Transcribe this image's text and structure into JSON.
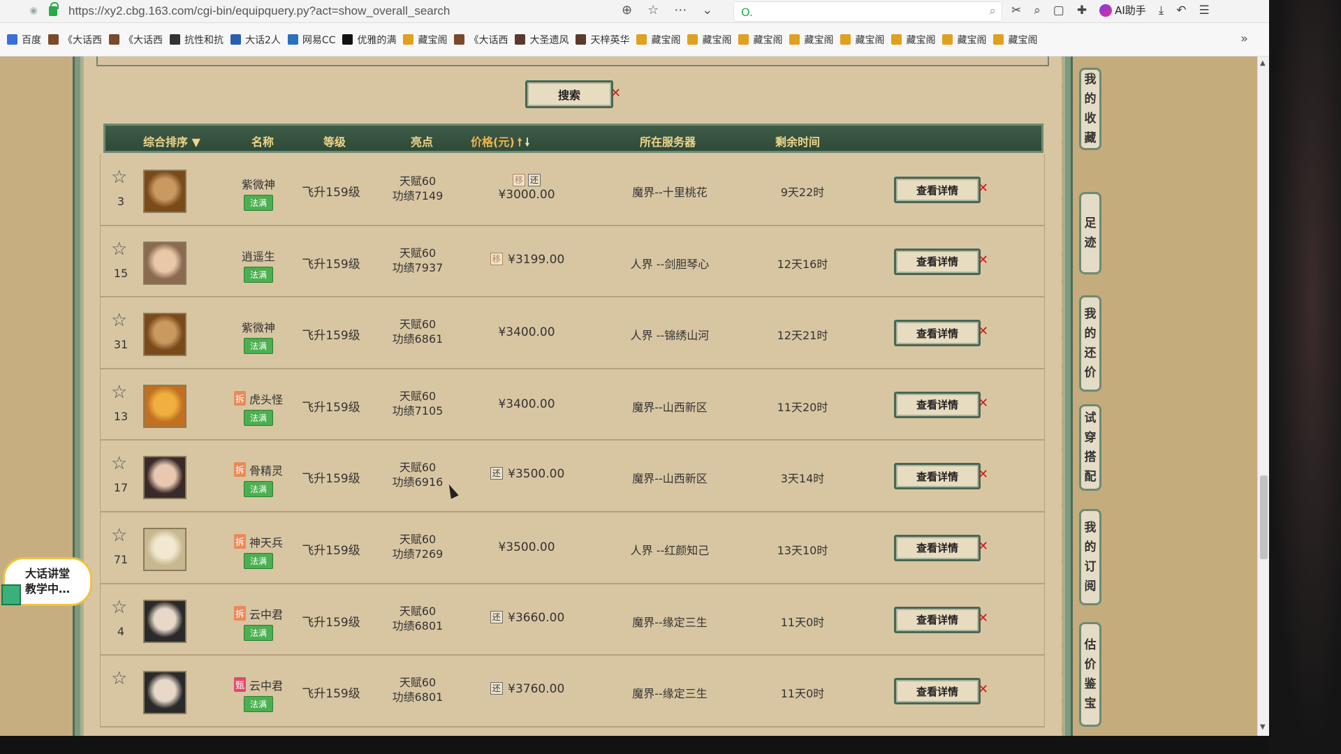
{
  "browser": {
    "url": "https://xy2.cbg.163.com/cgi-bin/equipquery.py?act=show_overall_search",
    "ai_label": "AI助手",
    "bookmarks": [
      "百度",
      "《大话西",
      "《大话西",
      "抗性和抗",
      "大话2人",
      "网易CC",
      "优雅的满",
      "藏宝阁",
      "《大话西",
      "大圣遗风",
      "天梓英华",
      "藏宝阁",
      "藏宝阁",
      "藏宝阁",
      "藏宝阁",
      "藏宝阁",
      "藏宝阁",
      "藏宝阁",
      "藏宝阁"
    ]
  },
  "search_button": "搜索",
  "table": {
    "headers": {
      "sort": "综合排序",
      "name": "名称",
      "level": "等级",
      "highlight": "亮点",
      "price": "价格(元)",
      "server": "所在服务器",
      "time": "剩余时间"
    },
    "detail_label": "查看详情",
    "rows": [
      {
        "rank": "3",
        "name": "紫微神",
        "tag": "",
        "badge": "法满",
        "level": "飞升159级",
        "hl1": "天赋60",
        "hl2": "功绩7149",
        "tags": [
          "移",
          "还"
        ],
        "price": "¥3000.00",
        "server": "魔界--十里桃花",
        "time": "9天22时"
      },
      {
        "rank": "15",
        "name": "逍遥生",
        "tag": "",
        "badge": "法满",
        "level": "飞升159级",
        "hl1": "天赋60",
        "hl2": "功绩7937",
        "tags": [
          "移"
        ],
        "price": "¥3199.00",
        "server": "人界 --剑胆琴心",
        "time": "12天16时"
      },
      {
        "rank": "31",
        "name": "紫微神",
        "tag": "",
        "badge": "法满",
        "level": "飞升159级",
        "hl1": "天赋60",
        "hl2": "功绩6861",
        "tags": [],
        "price": "¥3400.00",
        "server": "人界 --锦绣山河",
        "time": "12天21时"
      },
      {
        "rank": "13",
        "name": "虎头怪",
        "tag": "拆",
        "badge": "法满",
        "level": "飞升159级",
        "hl1": "天赋60",
        "hl2": "功绩7105",
        "tags": [],
        "price": "¥3400.00",
        "server": "魔界--山西新区",
        "time": "11天20时"
      },
      {
        "rank": "17",
        "name": "骨精灵",
        "tag": "拆",
        "badge": "法满",
        "level": "飞升159级",
        "hl1": "天赋60",
        "hl2": "功绩6916",
        "tags": [
          "还"
        ],
        "price": "¥3500.00",
        "server": "魔界--山西新区",
        "time": "3天14时"
      },
      {
        "rank": "71",
        "name": "神天兵",
        "tag": "拆",
        "badge": "法满",
        "level": "飞升159级",
        "hl1": "天赋60",
        "hl2": "功绩7269",
        "tags": [],
        "price": "¥3500.00",
        "server": "人界 --红颜知己",
        "time": "13天10时"
      },
      {
        "rank": "4",
        "name": "云中君",
        "tag": "拆",
        "badge": "法满",
        "level": "飞升159级",
        "hl1": "天赋60",
        "hl2": "功绩6801",
        "tags": [
          "还"
        ],
        "price": "¥3660.00",
        "server": "魔界--缘定三生",
        "time": "11天0时"
      },
      {
        "rank": "",
        "name": "云中君",
        "tag": "甄",
        "badge": "法满",
        "level": "飞升159级",
        "hl1": "天赋60",
        "hl2": "功绩6801",
        "tags": [
          "还"
        ],
        "price": "¥3760.00",
        "server": "魔界--缘定三生",
        "time": "11天0时"
      }
    ]
  },
  "sidebar": [
    "我的收藏",
    "足迹",
    "我的还价",
    "试穿搭配",
    "我的订阅",
    "估价鉴宝"
  ],
  "floating": {
    "line1": "大话讲堂",
    "line2": "教学中…"
  }
}
